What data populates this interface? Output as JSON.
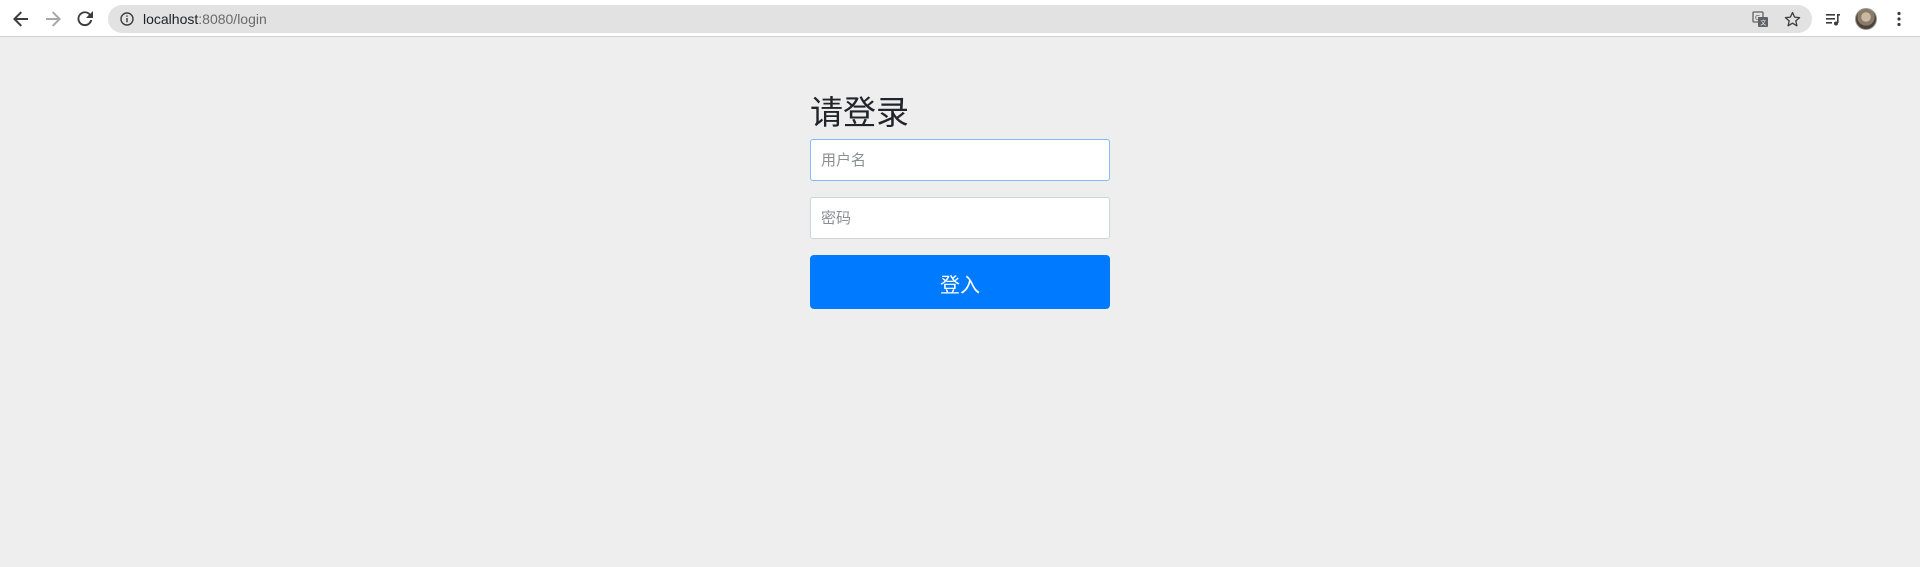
{
  "browser": {
    "url_host": "localhost",
    "url_rest": ":8080/login",
    "icons": {
      "back": "arrow-left-icon",
      "forward": "arrow-right-icon",
      "reload": "reload-icon",
      "info": "info-icon",
      "translate": "translate-icon",
      "bookmark": "star-icon",
      "media": "media-control-icon",
      "profile": "avatar",
      "menu": "kebab-menu-icon"
    }
  },
  "login": {
    "title": "请登录",
    "username_placeholder": "用户名",
    "password_placeholder": "密码",
    "submit_label": "登入"
  },
  "colors": {
    "page_background": "#eeeeee",
    "primary_button": "#007bff",
    "focused_border": "#80bdff"
  }
}
